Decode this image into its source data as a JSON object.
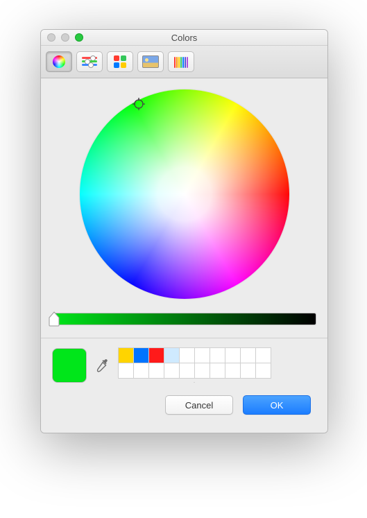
{
  "window": {
    "title": "Colors"
  },
  "tabs": {
    "wheel": {
      "name": "color-wheel-tab",
      "selected": true
    },
    "sliders": {
      "name": "color-sliders-tab",
      "selected": false
    },
    "palettes": {
      "name": "color-palettes-tab",
      "selected": false
    },
    "image": {
      "name": "image-palettes-tab",
      "selected": false
    },
    "pencils": {
      "name": "pencils-tab",
      "selected": false
    }
  },
  "selected_color": "#00e61a",
  "brightness_slider": {
    "value": 1.0,
    "gradient_from": "#00e61a",
    "gradient_to": "#000000"
  },
  "swatches": {
    "rows": 2,
    "cols": 10,
    "cells": [
      "#ffd400",
      "#0074ff",
      "#ff1a1a",
      "#cfeaff",
      null,
      null,
      null,
      null,
      null,
      null,
      null,
      null,
      null,
      null,
      null,
      null,
      null,
      null,
      null,
      null
    ]
  },
  "buttons": {
    "cancel": "Cancel",
    "ok": "OK"
  },
  "icons": {
    "pencil_colors": [
      "#ff3b30",
      "#ff9500",
      "#ffcc00",
      "#34c759",
      "#007aff",
      "#5856d6",
      "#af52de"
    ],
    "palette_colors": [
      "#ff3b30",
      "#34c759",
      "#007aff",
      "#ffcc00"
    ]
  }
}
